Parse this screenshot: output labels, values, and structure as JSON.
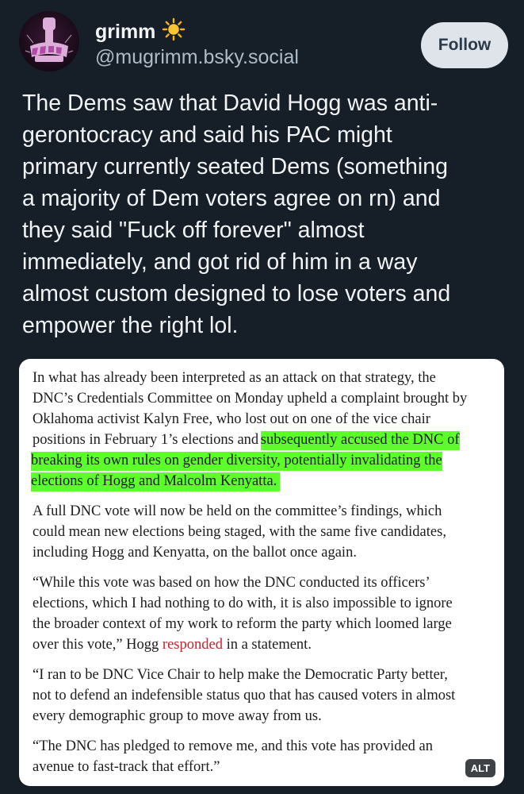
{
  "author": {
    "display_name": "grimm",
    "handle": "@mugrimm.bsky.social",
    "avatar_icon": "fist-logo-avatar",
    "name_emoji_icon": "sun-icon"
  },
  "follow_button": {
    "label": "Follow"
  },
  "post": {
    "text_lines": [
      "The Dems saw that David Hogg was anti-",
      "gerontocracy and said his PAC might",
      "primary currently seated Dems (something",
      "a majority of Dem voters agree on rn) and",
      "they said \"Fuck off forever\" almost",
      "immediately, and got rid of him in a way",
      "almost custom designed to lose voters and",
      "empower the right lol."
    ]
  },
  "image": {
    "alt_badge": "ALT",
    "highlight_color": "#5cff2a",
    "link_color": "#c0262d",
    "paragraphs": {
      "p1": {
        "l1": "In what has already been interpreted as an attack on that strategy, the",
        "l2": "DNC’s Credentials Committee on Monday upheld a complaint brought by",
        "l3": "Oklahoma activist Kalyn Free, who lost out on one of the vice chair",
        "l4_plain": "positions in February 1’s elections and ",
        "l4_hl": "subsequently accused the DNC of",
        "l5_hl": "breaking its own rules on gender diversity, potentially invalidating the",
        "l6_hl": "elections of Hogg and Malcolm Kenyatta."
      },
      "p2": {
        "l1": "A full DNC vote will now be held on the committee’s findings, which",
        "l2": "could mean new elections being staged, with the same five candidates,",
        "l3": "including Hogg and Kenyatta, on the ballot once again."
      },
      "p3": {
        "l1": "“While this vote was based on how the DNC conducted its officers’",
        "l2": "elections, which I had nothing to do with, it is also impossible to ignore",
        "l3": "the broader context of my work to reform the party which loomed large",
        "l4_pre": "over this vote,” Hogg ",
        "l4_link": "responded",
        "l4_post": " in a statement."
      },
      "p4": {
        "l1": "“I ran to be DNC Vice Chair to help make the Democratic Party better,",
        "l2": "not to defend an indefensible status quo that has caused voters in almost",
        "l3": "every demographic group to move away from us."
      },
      "p5": {
        "l1": "“The DNC has pledged to remove me, and this vote has provided an",
        "l2": "avenue to fast-track that effort.”"
      }
    }
  }
}
